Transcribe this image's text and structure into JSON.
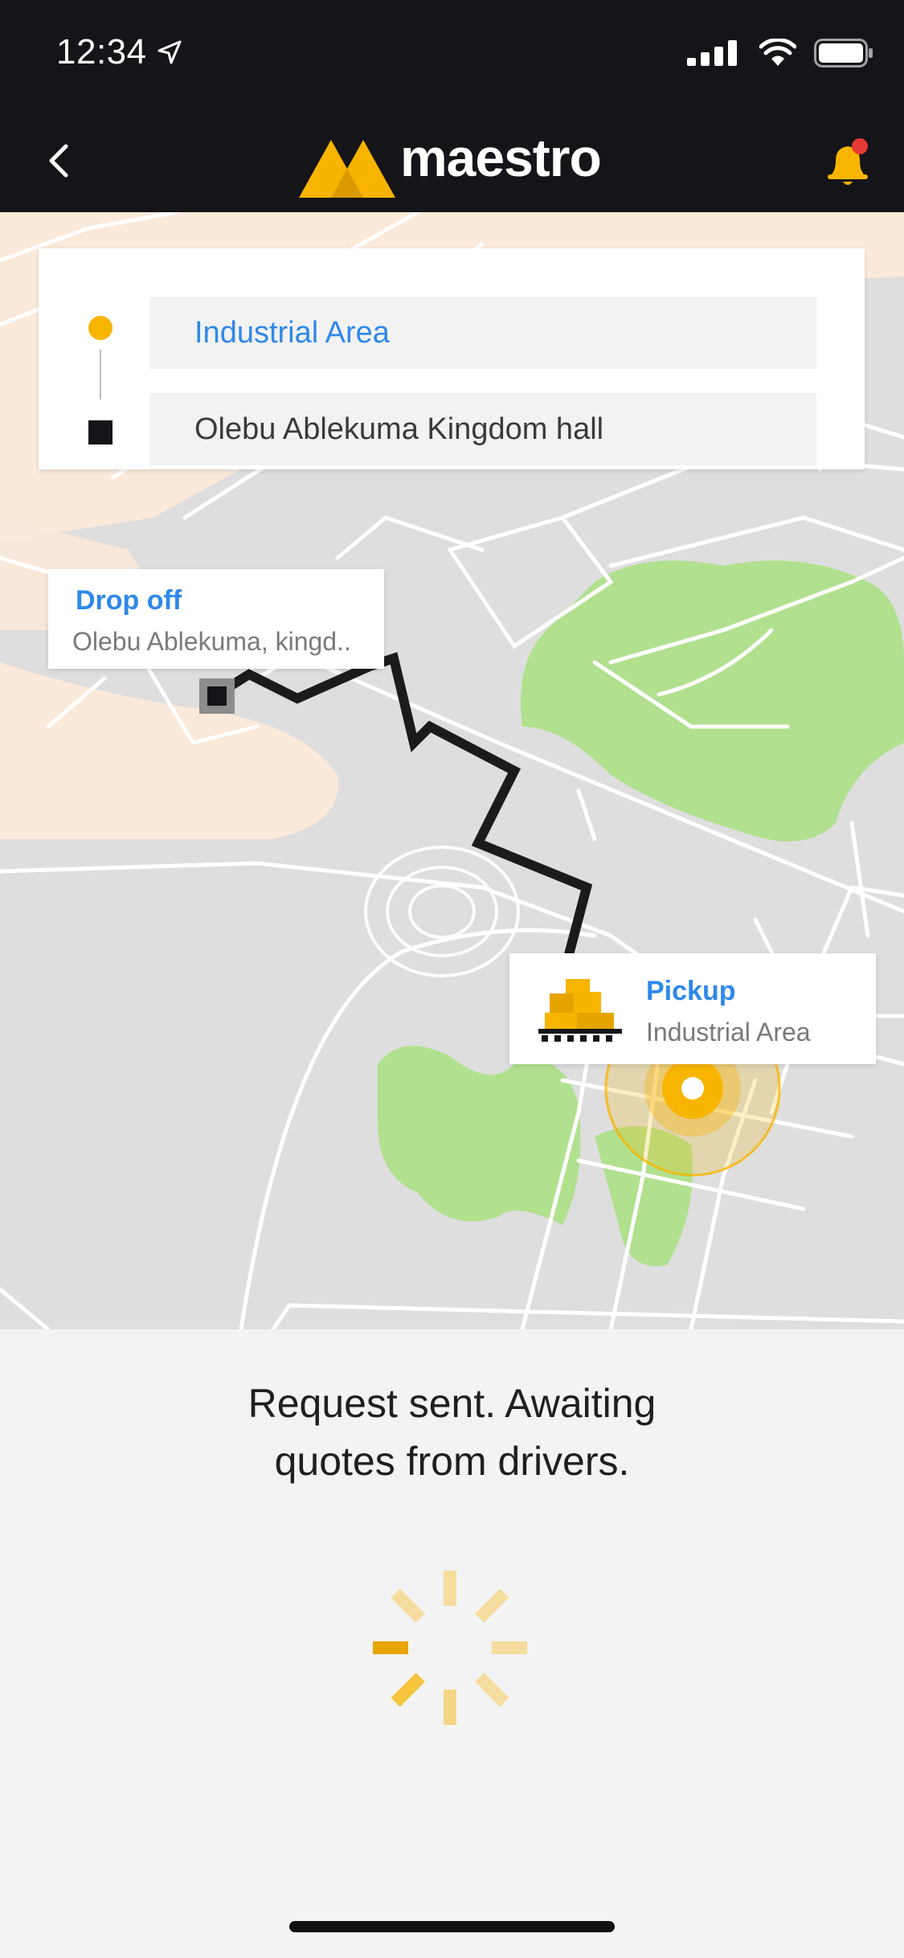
{
  "status_bar": {
    "time": "12:34"
  },
  "header": {
    "brand": "maestro",
    "accent_color": "#F7B500",
    "notification_badge_color": "#E53935"
  },
  "route": {
    "pickup_value": "Industrial Area",
    "dropoff_value": "Olebu Ablekuma Kingdom hall"
  },
  "map": {
    "dropoff_callout": {
      "title": "Drop off",
      "subtitle": "Olebu Ablekuma, kingd.."
    },
    "pickup_callout": {
      "title": "Pickup",
      "subtitle": "Industrial Area"
    }
  },
  "status": {
    "line1": "Request sent. Awaiting",
    "line2": "quotes from drivers."
  },
  "icons": [
    "location-arrow-icon",
    "signal-icon",
    "wifi-icon",
    "battery-icon",
    "back-chevron-icon",
    "maestro-logo",
    "bell-icon",
    "pickup-dot-icon",
    "dropoff-square-icon",
    "cargo-crate-icon",
    "loading-spinner-icon"
  ]
}
